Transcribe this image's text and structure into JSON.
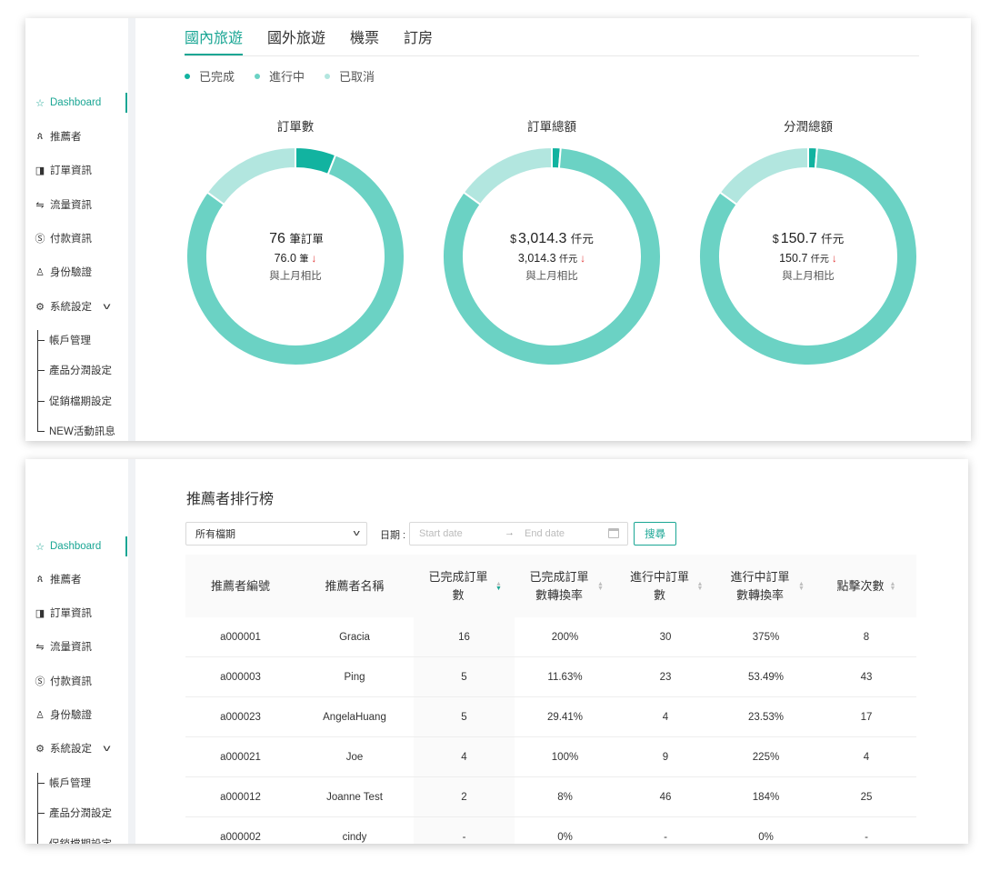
{
  "sidebar": {
    "items": [
      {
        "label": "Dashboard",
        "icon": "star-icon"
      },
      {
        "label": "推薦者",
        "icon": "users-icon"
      },
      {
        "label": "訂單資訊",
        "icon": "order-icon"
      },
      {
        "label": "流量資訊",
        "icon": "swap-icon"
      },
      {
        "label": "付款資訊",
        "icon": "dollar-icon"
      },
      {
        "label": "身份驗證",
        "icon": "user-icon"
      },
      {
        "label": "系統設定",
        "icon": "gear-icon"
      }
    ],
    "sub_items": [
      "帳戶管理",
      "產品分潤設定",
      "促銷檔期設定",
      "NEW活動訊息"
    ],
    "bottom_sub_items": [
      "帳戶管理",
      "產品分潤設定",
      "促銷檔期設定"
    ]
  },
  "tabs": [
    "國內旅遊",
    "國外旅遊",
    "機票",
    "訂房"
  ],
  "legend": [
    {
      "label": "已完成",
      "color": "#12b3a0"
    },
    {
      "label": "進行中",
      "color": "#6bd2c4"
    },
    {
      "label": "已取消",
      "color": "#b2e6df"
    }
  ],
  "chart_data": [
    {
      "type": "pie",
      "title": "訂單數",
      "categories": [
        "已完成",
        "進行中",
        "已取消"
      ],
      "values": [
        6,
        79,
        15
      ],
      "center": {
        "currency": "",
        "value": "76",
        "unit": "筆訂單",
        "prev_value": "76.0",
        "prev_unit": "筆",
        "note": "與上月相比"
      }
    },
    {
      "type": "pie",
      "title": "訂單總額",
      "categories": [
        "已完成",
        "進行中",
        "已取消"
      ],
      "values": [
        1.3,
        83.7,
        15
      ],
      "center": {
        "currency": "$",
        "value": "3,014.3",
        "unit": "仟元",
        "prev_value": "3,014.3",
        "prev_unit": "仟元",
        "note": "與上月相比"
      }
    },
    {
      "type": "pie",
      "title": "分潤總額",
      "categories": [
        "已完成",
        "進行中",
        "已取消"
      ],
      "values": [
        1.3,
        83.7,
        15
      ],
      "center": {
        "currency": "$",
        "value": "150.7",
        "unit": "仟元",
        "prev_value": "150.7",
        "prev_unit": "仟元",
        "note": "與上月相比"
      }
    }
  ],
  "ranking": {
    "title": "推薦者排行榜",
    "filter_select": "所有檔期",
    "date_label": "日期 :",
    "start_placeholder": "Start date",
    "end_placeholder": "End date",
    "search_label": "搜尋",
    "columns": [
      "推薦者編號",
      "推薦者名稱",
      "已完成訂單數",
      "已完成訂單數轉換率",
      "進行中訂單數",
      "進行中訂單數轉換率",
      "點擊次數"
    ],
    "rows": [
      [
        "a000001",
        "Gracia",
        "16",
        "200%",
        "30",
        "375%",
        "8"
      ],
      [
        "a000003",
        "Ping",
        "5",
        "11.63%",
        "23",
        "53.49%",
        "43"
      ],
      [
        "a000023",
        "AngelaHuang",
        "5",
        "29.41%",
        "4",
        "23.53%",
        "17"
      ],
      [
        "a000021",
        "Joe",
        "4",
        "100%",
        "9",
        "225%",
        "4"
      ],
      [
        "a000012",
        "Joanne Test",
        "2",
        "8%",
        "46",
        "184%",
        "25"
      ],
      [
        "a000002",
        "cindy",
        "-",
        "0%",
        "-",
        "0%",
        "-"
      ]
    ]
  }
}
